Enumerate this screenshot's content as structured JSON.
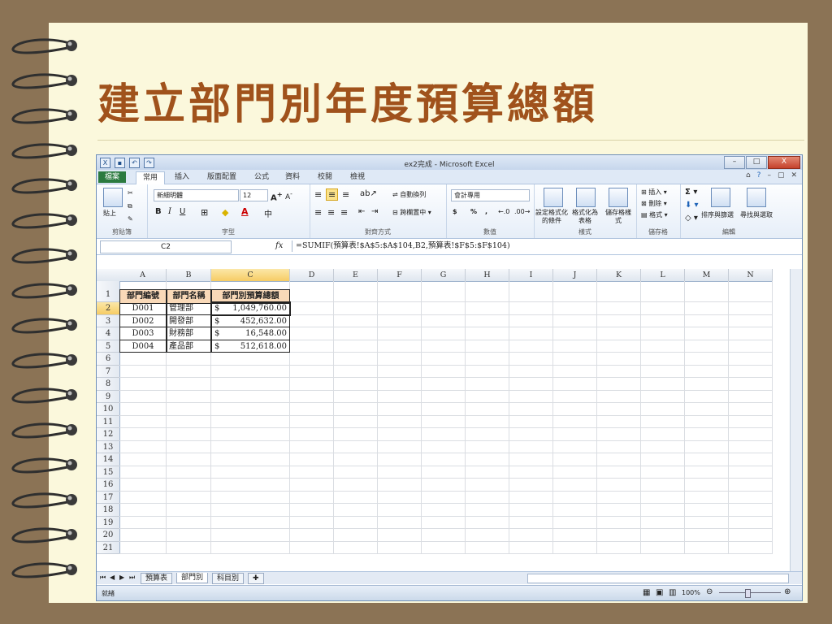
{
  "slide": {
    "title": "建立部門別年度預算總額"
  },
  "window": {
    "title": "ex2完成 - Microsoft Excel",
    "min_label": "–",
    "max_label": "□",
    "close_label": "X"
  },
  "ribbon_tabs": [
    "檔案",
    "常用",
    "插入",
    "版面配置",
    "公式",
    "資料",
    "校閱",
    "檢視"
  ],
  "active_tab": "常用",
  "ribbon": {
    "clipboard": {
      "paste": "貼上",
      "label": "剪貼簿"
    },
    "font": {
      "name": "新細明體",
      "size": "12",
      "label": "字型",
      "bold": "B",
      "italic": "I",
      "underline": "U"
    },
    "alignment": {
      "wrap": "自動換列",
      "merge": "跨欄置中",
      "label": "對齊方式"
    },
    "number": {
      "format": "會計專用",
      "currency": "$",
      "percent": "%",
      "comma": ",",
      "label": "數值"
    },
    "styles": {
      "conditional": "設定格式化的條件",
      "as_table": "格式化為表格",
      "cell_styles": "儲存格樣式",
      "label": "樣式"
    },
    "cells": {
      "insert": "插入",
      "delete": "刪除",
      "format": "格式",
      "label": "儲存格"
    },
    "editing": {
      "sort": "排序與篩選",
      "find": "尋找與選取",
      "label": "編輯"
    }
  },
  "formula_bar": {
    "name_box": "C2",
    "fx": "fx",
    "formula": "=SUMIF(預算表!$A$5:$A$104,B2,預算表!$F$5:$F$104)"
  },
  "columns": [
    "A",
    "B",
    "C",
    "D",
    "E",
    "F",
    "G",
    "H",
    "I",
    "J",
    "K",
    "L",
    "M",
    "N"
  ],
  "rows": [
    "1",
    "2",
    "3",
    "4",
    "5",
    "6",
    "7",
    "8",
    "9",
    "10",
    "11",
    "12",
    "13",
    "14",
    "15",
    "16",
    "17",
    "18",
    "19",
    "20",
    "21"
  ],
  "table": {
    "headers": [
      "部門編號",
      "部門名稱",
      "部門別預算總額"
    ],
    "data": [
      {
        "id": "D001",
        "name": "管理部",
        "currency": "$",
        "amount": "1,049,760.00"
      },
      {
        "id": "D002",
        "name": "開發部",
        "currency": "$",
        "amount": "452,632.00"
      },
      {
        "id": "D003",
        "name": "財務部",
        "currency": "$",
        "amount": "16,548.00"
      },
      {
        "id": "D004",
        "name": "產品部",
        "currency": "$",
        "amount": "512,618.00"
      }
    ]
  },
  "sheet_tabs": [
    "預算表",
    "部門別",
    "科目別"
  ],
  "active_sheet": "部門別",
  "status": {
    "ready": "就緒",
    "zoom": "100%"
  },
  "colors": {
    "slide_title": "#a0521c",
    "header_fill": "#f9d9b8",
    "file_tab": "#2b7a3f",
    "selected_header": "#f6cc64"
  }
}
